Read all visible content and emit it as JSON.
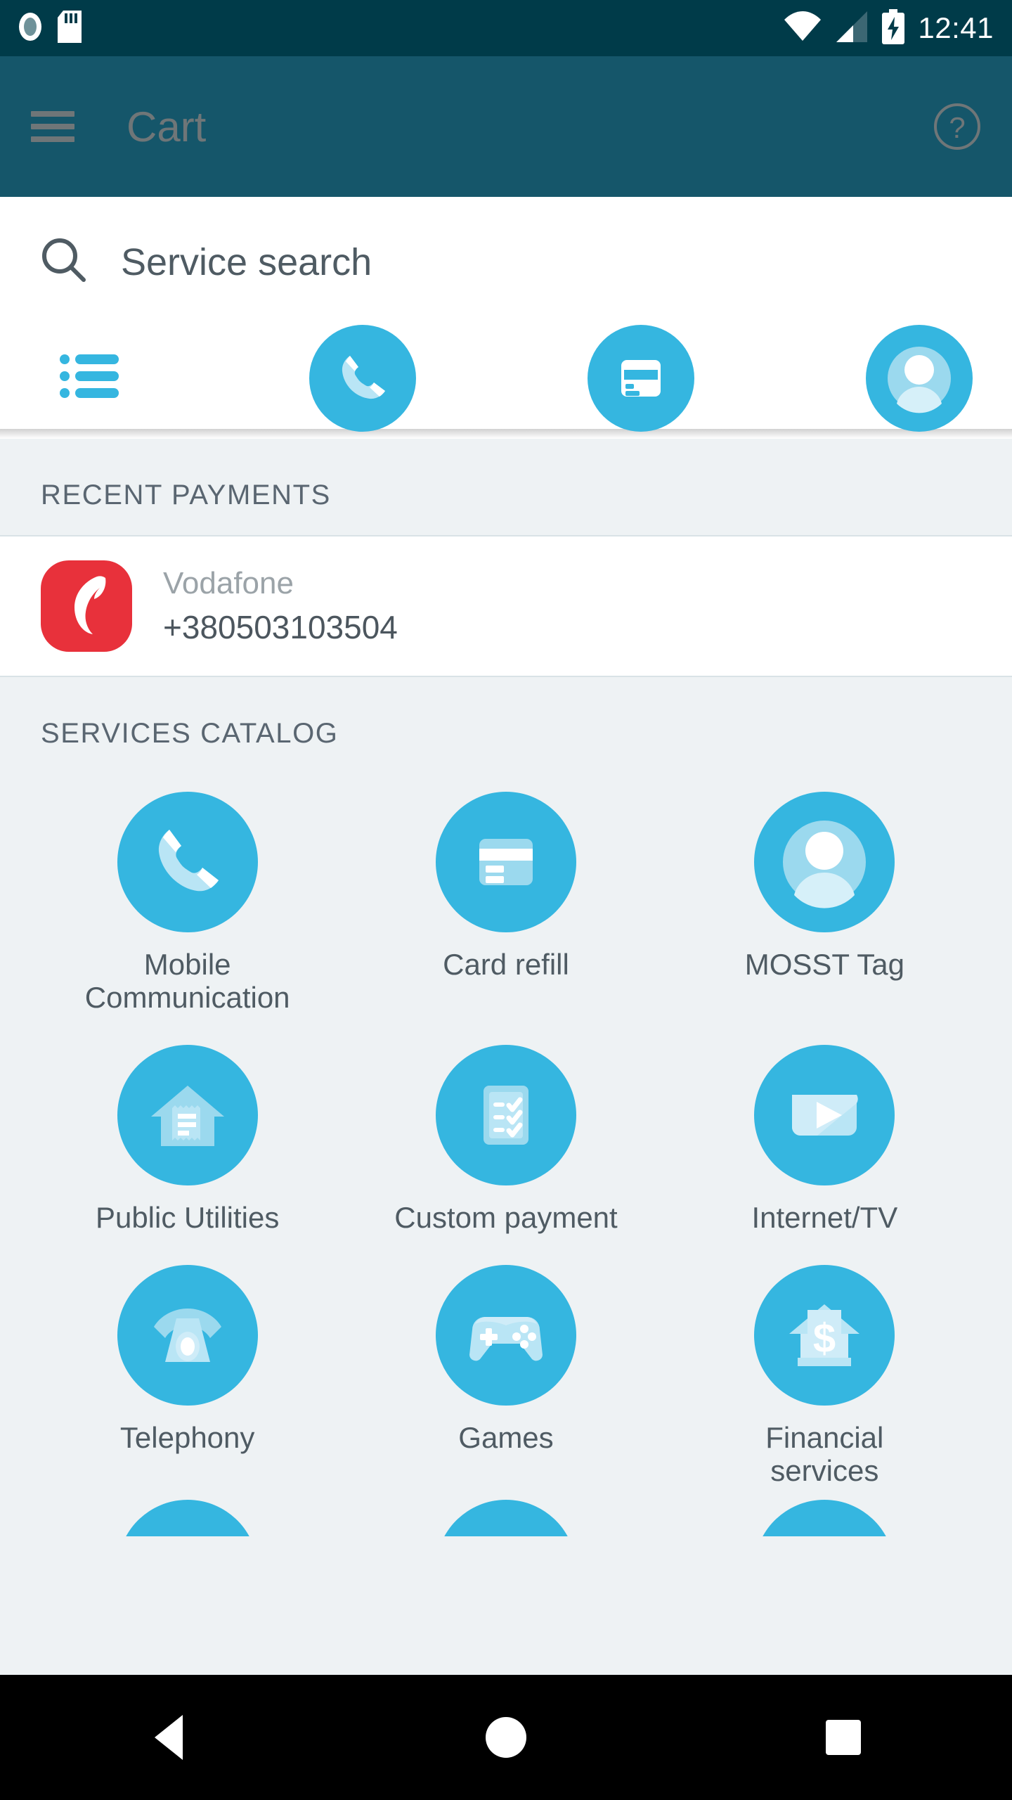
{
  "status_bar": {
    "time": "12:41",
    "icons": [
      "nfc-icon",
      "sd-card-icon",
      "wifi-icon",
      "cellular-signal-icon",
      "battery-charging-icon"
    ]
  },
  "app_bar": {
    "menu_icon": "hamburger-menu-icon",
    "title": "Cart",
    "help_icon": "help-circle-icon",
    "background_color": "#15566a",
    "title_color": "#6f7678"
  },
  "search": {
    "icon": "search-icon",
    "placeholder": "Service search"
  },
  "quick_actions": [
    {
      "name": "list",
      "icon": "list-icon",
      "styled": "plain"
    },
    {
      "name": "mobile",
      "icon": "phone-icon",
      "styled": "circle"
    },
    {
      "name": "card",
      "icon": "credit-card-icon",
      "styled": "circle"
    },
    {
      "name": "account",
      "icon": "person-icon",
      "styled": "circle"
    }
  ],
  "recent_payments": {
    "header": "RECENT PAYMENTS",
    "items": [
      {
        "logo": "vodafone-logo",
        "logo_color": "#e8313b",
        "provider": "Vodafone",
        "account": "+380503103504"
      }
    ]
  },
  "services_catalog": {
    "header": "SERVICES CATALOG",
    "accent_color": "#35b6e0",
    "items": [
      {
        "label": "Mobile Communication",
        "icon": "phone-icon"
      },
      {
        "label": "Card refill",
        "icon": "credit-card-icon"
      },
      {
        "label": "MOSST Tag",
        "icon": "person-icon"
      },
      {
        "label": "Public Utilities",
        "icon": "house-receipt-icon"
      },
      {
        "label": "Custom payment",
        "icon": "checklist-icon"
      },
      {
        "label": "Internet/TV",
        "icon": "play-tv-icon"
      },
      {
        "label": "Telephony",
        "icon": "landline-phone-icon"
      },
      {
        "label": "Games",
        "icon": "gamepad-icon"
      },
      {
        "label": "Financial services",
        "icon": "bank-dollar-icon"
      }
    ]
  },
  "navigation_bar": {
    "back": "back-nav-icon",
    "home": "home-nav-icon",
    "recents": "recents-nav-icon"
  }
}
